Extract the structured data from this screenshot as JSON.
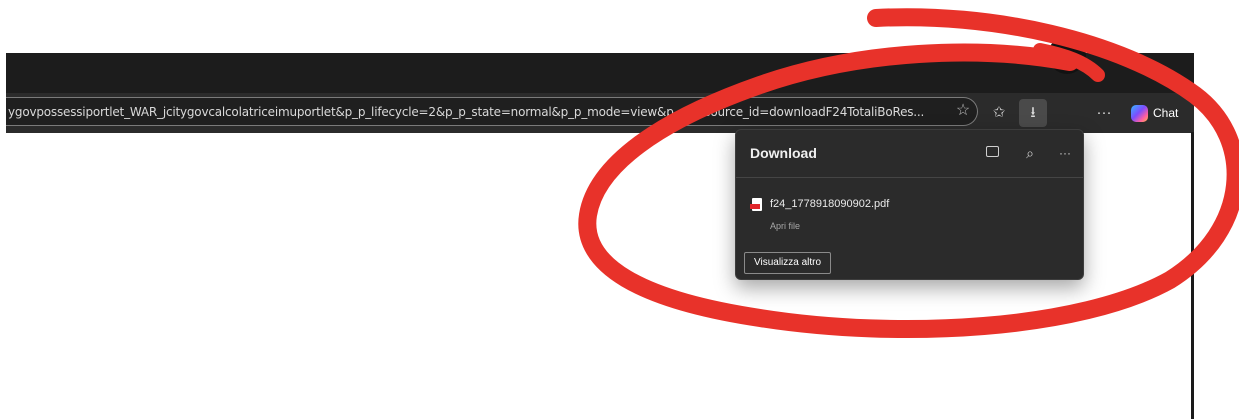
{
  "browser": {
    "address_bar": {
      "url": "ygovpossessiportlet_WAR_jcitygovcalcolatriceimuportlet&p_p_lifecycle=2&p_p_state=normal&p_p_mode=view&p_p_resource_id=downloadF24TotaliBoRes..."
    },
    "toolbar": {
      "chat_label": "Chat",
      "more_label": "···"
    }
  },
  "downloads_panel": {
    "title": "Download",
    "more_label": "···",
    "items": [
      {
        "file_name": "f24_1778918090902.pdf",
        "action_label": "Apri file"
      }
    ],
    "show_more_label": "Visualizza altro"
  },
  "colors": {
    "annotation_circle": "#e8322a",
    "panel_background": "#2b2b2b",
    "toolbar_background": "#2b2b2b"
  }
}
